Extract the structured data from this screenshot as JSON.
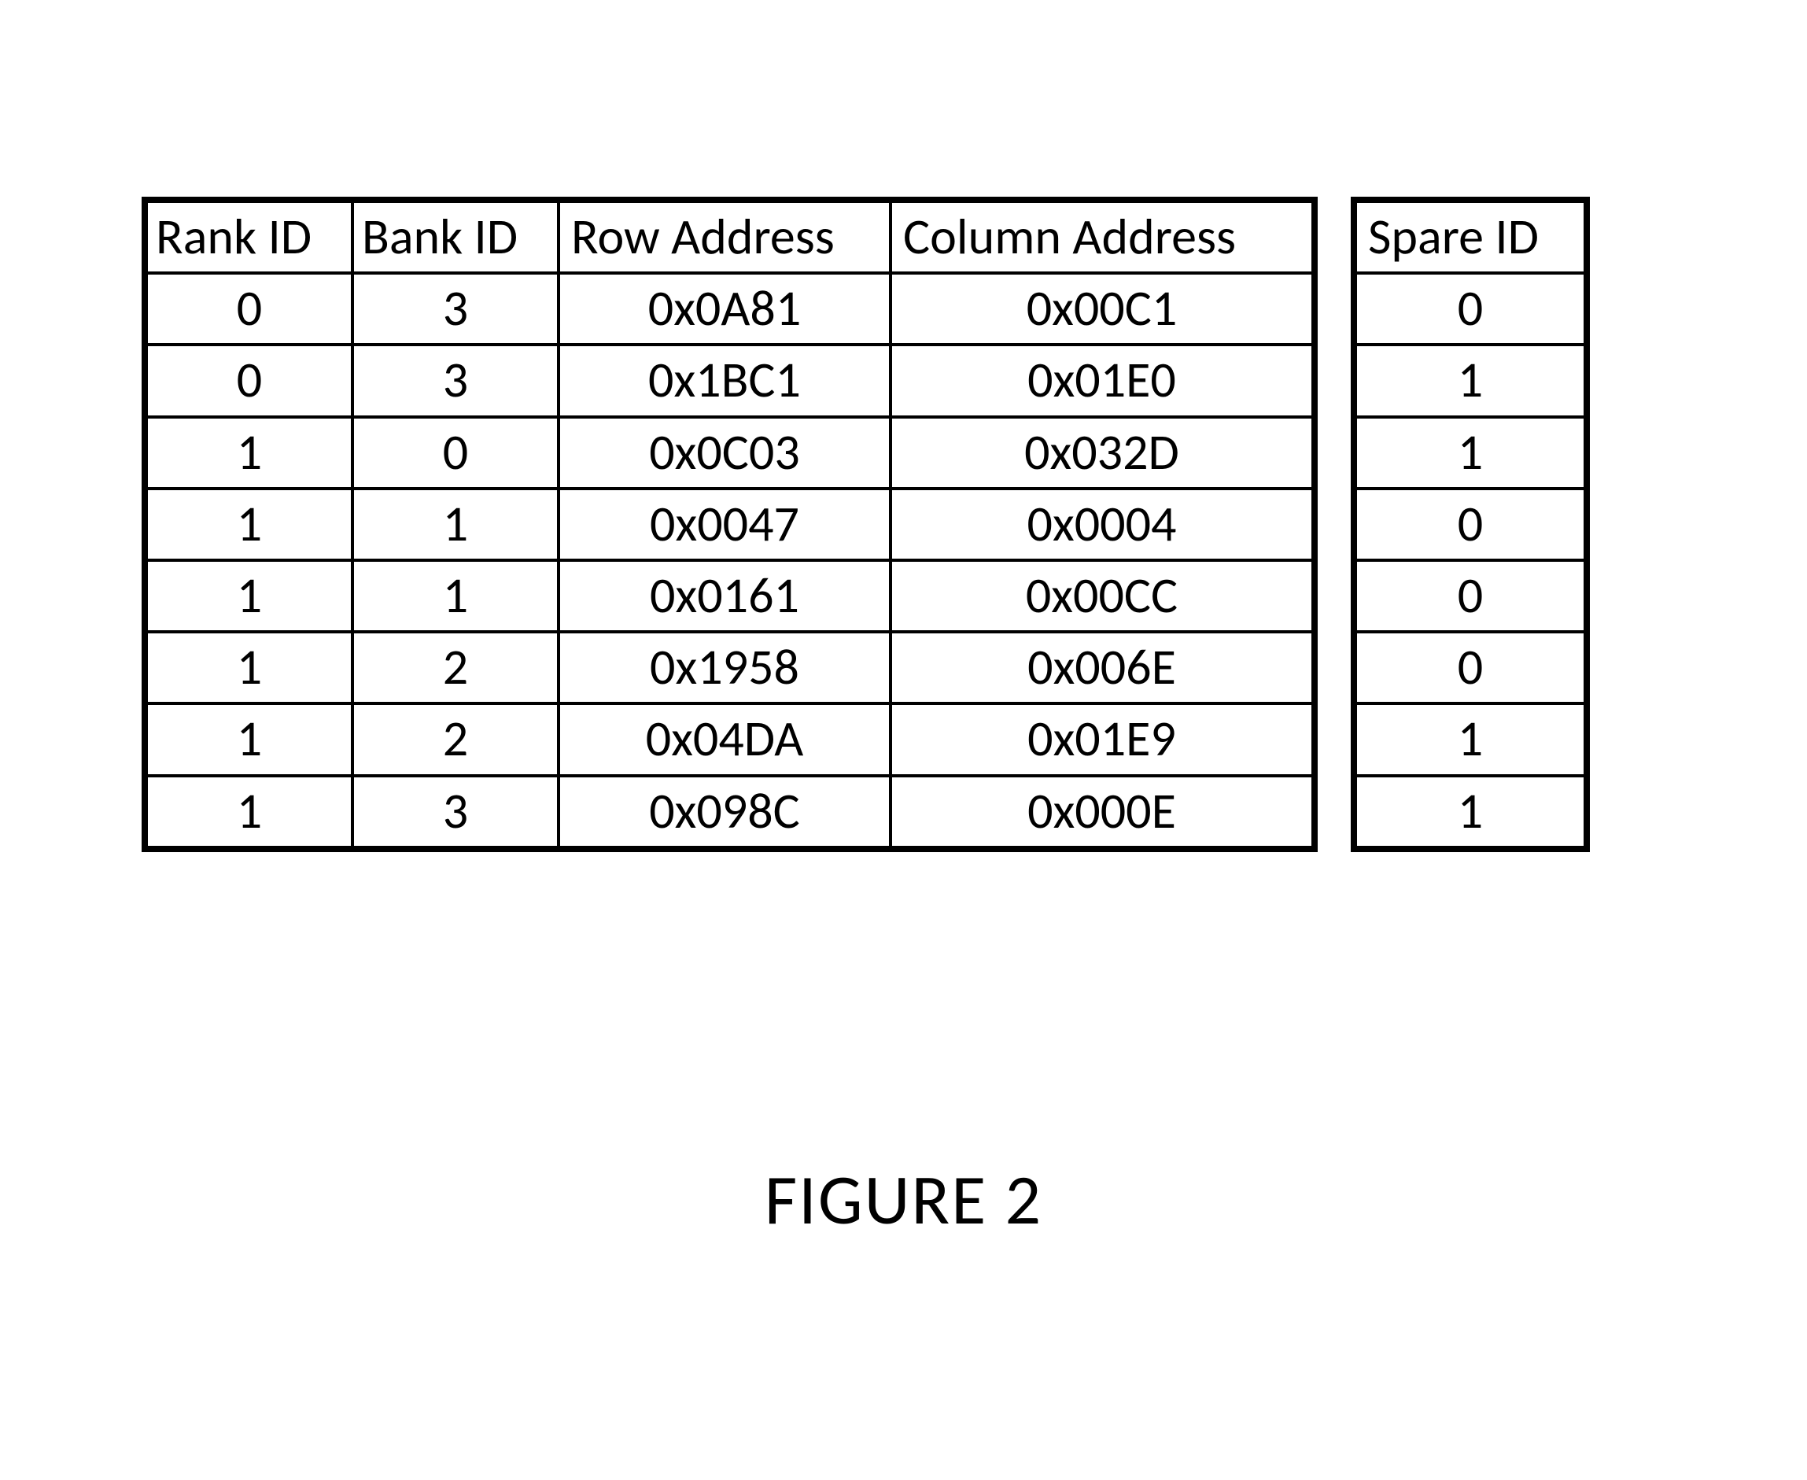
{
  "table": {
    "headers": {
      "rank": "Rank ID",
      "bank": "Bank ID",
      "row": "Row Address",
      "col": "Column Address",
      "spare": "Spare ID"
    },
    "rows": [
      {
        "rank": "0",
        "bank": "3",
        "row": "0x0A81",
        "col": "0x00C1",
        "spare": "0"
      },
      {
        "rank": "0",
        "bank": "3",
        "row": "0x1BC1",
        "col": "0x01E0",
        "spare": "1"
      },
      {
        "rank": "1",
        "bank": "0",
        "row": "0x0C03",
        "col": "0x032D",
        "spare": "1"
      },
      {
        "rank": "1",
        "bank": "1",
        "row": "0x0047",
        "col": "0x0004",
        "spare": "0"
      },
      {
        "rank": "1",
        "bank": "1",
        "row": "0x0161",
        "col": "0x00CC",
        "spare": "0"
      },
      {
        "rank": "1",
        "bank": "2",
        "row": "0x1958",
        "col": "0x006E",
        "spare": "0"
      },
      {
        "rank": "1",
        "bank": "2",
        "row": "0x04DA",
        "col": "0x01E9",
        "spare": "1"
      },
      {
        "rank": "1",
        "bank": "3",
        "row": "0x098C",
        "col": "0x000E",
        "spare": "1"
      }
    ]
  },
  "caption": "FIGURE 2"
}
